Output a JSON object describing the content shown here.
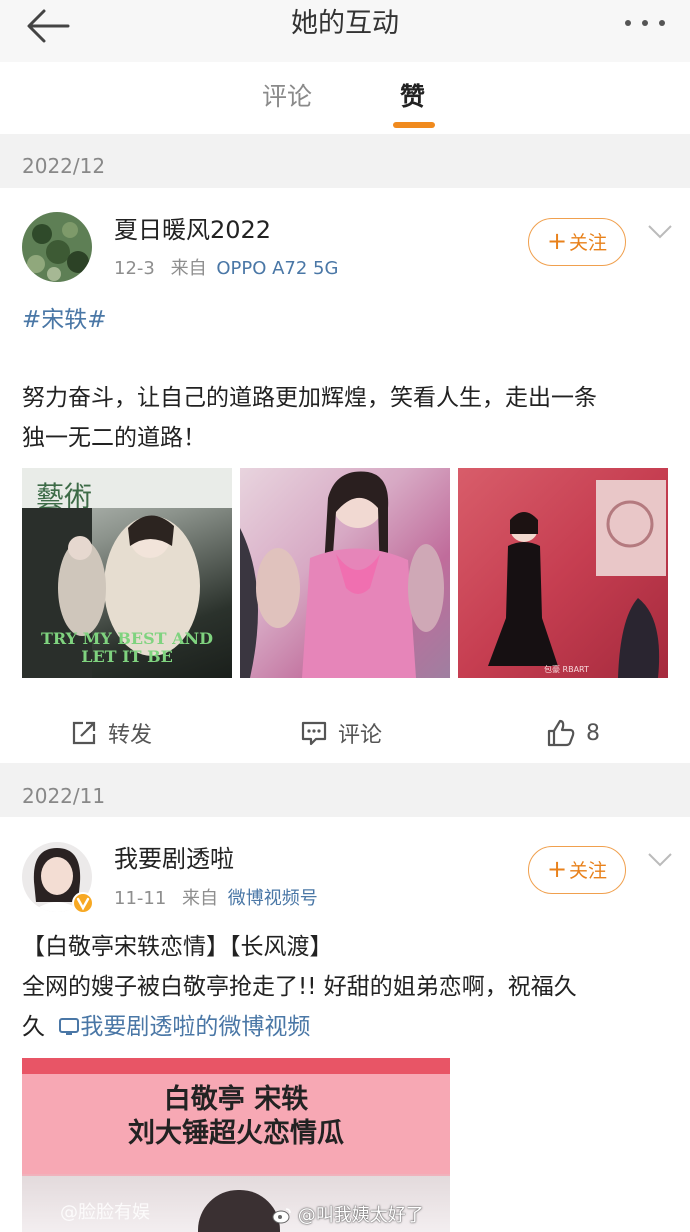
{
  "header": {
    "title": "她的互动"
  },
  "tabs": [
    {
      "label": "评论"
    },
    {
      "label": "赞"
    }
  ],
  "sections": [
    {
      "date": "2022/12",
      "post": {
        "username": "夏日暖风2022",
        "time": "12-3",
        "from_prefix": "来自",
        "source": "OPPO A72 5G",
        "follow_label": "关注",
        "hashtag": "#宋轶#",
        "text_lines": [
          "努力奋斗，让自己的道路更加辉煌，笑看人生，走出一条",
          "独一无二的道路！"
        ],
        "image_texts": {
          "img1_line1": "TRY MY BEST AND",
          "img1_line2": "LET IT BE"
        },
        "actions": {
          "repost": "转发",
          "comment": "评论",
          "like_count": "8"
        }
      }
    },
    {
      "date": "2022/11",
      "post": {
        "username": "我要剧透啦",
        "time": "11-11",
        "from_prefix": "来自",
        "source": "微博视频号",
        "follow_label": "关注",
        "line1": "【白敬亭宋轶恋情】【长风渡】",
        "line2": "全网的嫂子被白敬亭抢走了!! 好甜的姐弟恋啊，祝福久",
        "line3_prefix": "久",
        "video_link": "我要剧透啦的微博视频",
        "video_title_1": "白敬亭 宋轶",
        "video_title_2": "刘大锤超火恋情瓜",
        "video_watermark": "@脸脸有娱"
      }
    }
  ],
  "watermark": "@叫我姨太好了",
  "colors": {
    "accent": "#f08a1e",
    "link": "#4a77a6",
    "divider": "#f2f2f2"
  },
  "icons": [
    "back-arrow-icon",
    "more-dots-icon",
    "chevron-down-icon",
    "plus-icon",
    "repost-icon",
    "comment-icon",
    "like-icon",
    "video-icon",
    "weibo-logo-icon"
  ]
}
